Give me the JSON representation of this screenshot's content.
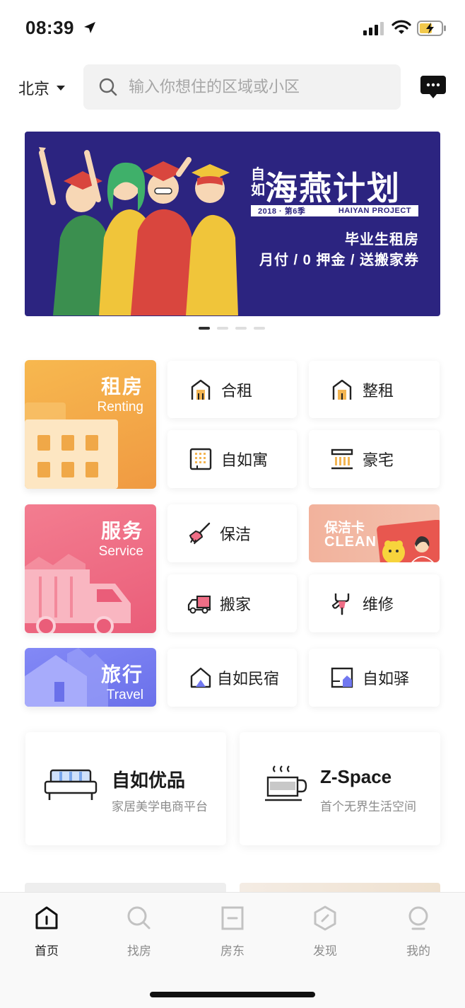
{
  "status_bar": {
    "time": "08:39"
  },
  "header": {
    "city": "北京",
    "search_placeholder": "输入你想住的区域或小区"
  },
  "banner": {
    "brand": "自如",
    "title": "海燕计划",
    "strip_left": "2018 · 第6季",
    "strip_right": "HAIYAN PROJECT",
    "line1": "毕业生租房",
    "line2": "月付 / 0 押金 / 送搬家券",
    "page_count": 4,
    "active_page": 1
  },
  "categories": {
    "renting": {
      "cn": "租房",
      "en": "Renting",
      "color": "#f2a64b"
    },
    "service": {
      "cn": "服务",
      "en": "Service",
      "color": "#ef6e86"
    },
    "travel": {
      "cn": "旅行",
      "en": "Travel",
      "color": "#7178f0"
    }
  },
  "tiles": {
    "shared_rent": "合租",
    "whole_rent": "整租",
    "ziroom_apartment": "自如寓",
    "mansion": "豪宅",
    "cleaning": "保洁",
    "clean_card_cn": "保洁卡",
    "clean_card_en": "CLEAN",
    "moving": "搬家",
    "repair": "维修",
    "homestay": "自如民宿",
    "inn": "自如驿"
  },
  "promos": [
    {
      "title": "自如优品",
      "subtitle": "家居美学电商平台",
      "icon": "sofa-icon"
    },
    {
      "title": "Z-Space",
      "subtitle": "首个无界生活空间",
      "icon": "coffee-cup-icon"
    }
  ],
  "tabbar": {
    "items": [
      {
        "label": "首页",
        "icon": "home-icon",
        "active": true
      },
      {
        "label": "找房",
        "icon": "search-icon",
        "active": false
      },
      {
        "label": "房东",
        "icon": "landlord-icon",
        "active": false
      },
      {
        "label": "发现",
        "icon": "discover-icon",
        "active": false
      },
      {
        "label": "我的",
        "icon": "profile-icon",
        "active": false
      }
    ]
  },
  "colors": {
    "accent_orange": "#f2a64b",
    "accent_pink": "#ef6e86",
    "accent_purple": "#7178f0",
    "banner_bg": "#2c2480"
  }
}
